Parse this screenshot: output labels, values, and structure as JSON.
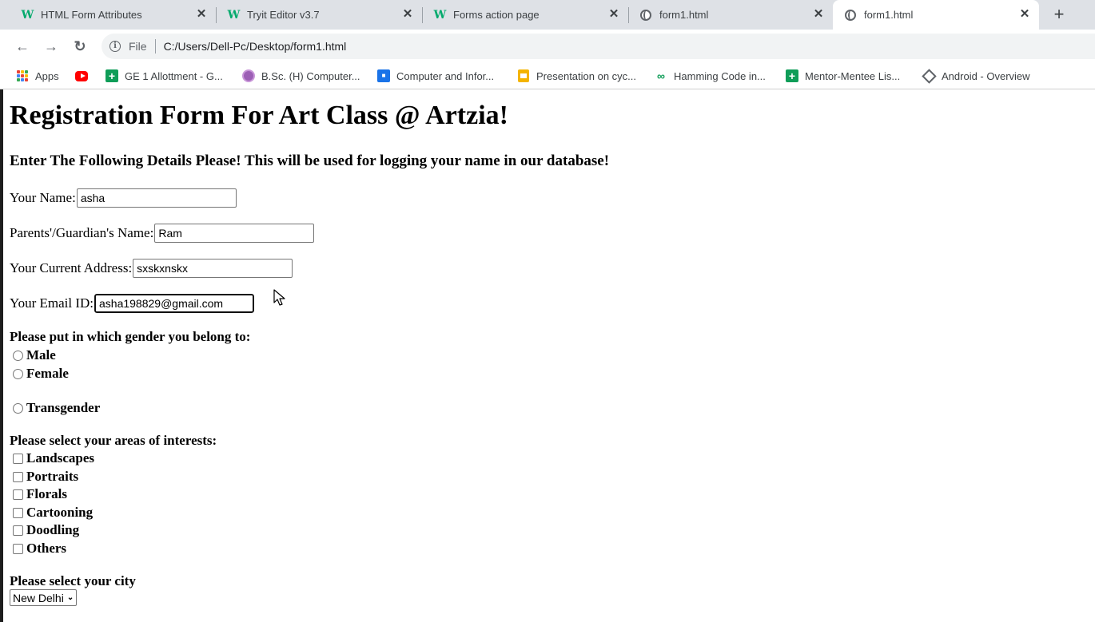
{
  "browser": {
    "tabs": [
      {
        "title": "HTML Form Attributes",
        "icon": "w3schools-icon",
        "active": false
      },
      {
        "title": "Tryit Editor v3.7",
        "icon": "w3schools-icon",
        "active": false
      },
      {
        "title": "Forms action page",
        "icon": "w3schools-icon",
        "active": false
      },
      {
        "title": "form1.html",
        "icon": "globe-icon",
        "active": false
      },
      {
        "title": "form1.html",
        "icon": "globe-icon",
        "active": true
      }
    ],
    "address": {
      "scheme_label": "File",
      "url": "C:/Users/Dell-Pc/Desktop/form1.html"
    },
    "bookmarks": [
      {
        "label": "Apps",
        "icon": "apps-icon"
      },
      {
        "label": "",
        "icon": "youtube-icon"
      },
      {
        "label": "GE 1 Allottment - G...",
        "icon": "sheets-icon"
      },
      {
        "label": "B.Sc. (H) Computer...",
        "icon": "circle-icon"
      },
      {
        "label": "Computer and Infor...",
        "icon": "blue-square-icon"
      },
      {
        "label": "Presentation on cyc...",
        "icon": "slides-icon"
      },
      {
        "label": "Hamming Code in...",
        "icon": "infinity-icon"
      },
      {
        "label": "Mentor-Mentee Lis...",
        "icon": "sheets-icon"
      },
      {
        "label": "Android - Overview",
        "icon": "android-icon"
      }
    ]
  },
  "form": {
    "heading": "Registration Form For Art Class @ Artzia!",
    "subheading": "Enter The Following Details Please! This will be used for logging your name in our database!",
    "fields": [
      {
        "label": "Your Name:",
        "value": "asha"
      },
      {
        "label": "Parents'/Guardian's Name:",
        "value": "Ram"
      },
      {
        "label": "Your Current Address:",
        "value": "sxskxnskx"
      },
      {
        "label": "Your Email ID:",
        "value": "asha198829@gmail.com"
      }
    ],
    "gender": {
      "question": "Please put in which gender you belong to:",
      "options": [
        "Male",
        "Female",
        "Transgender"
      ]
    },
    "interests": {
      "question": "Please select your areas of interests:",
      "options": [
        "Landscapes",
        "Portraits",
        "Florals",
        "Cartooning",
        "Doodling",
        "Others"
      ]
    },
    "city": {
      "question": "Please select your city",
      "selected": "New Delhi"
    }
  }
}
